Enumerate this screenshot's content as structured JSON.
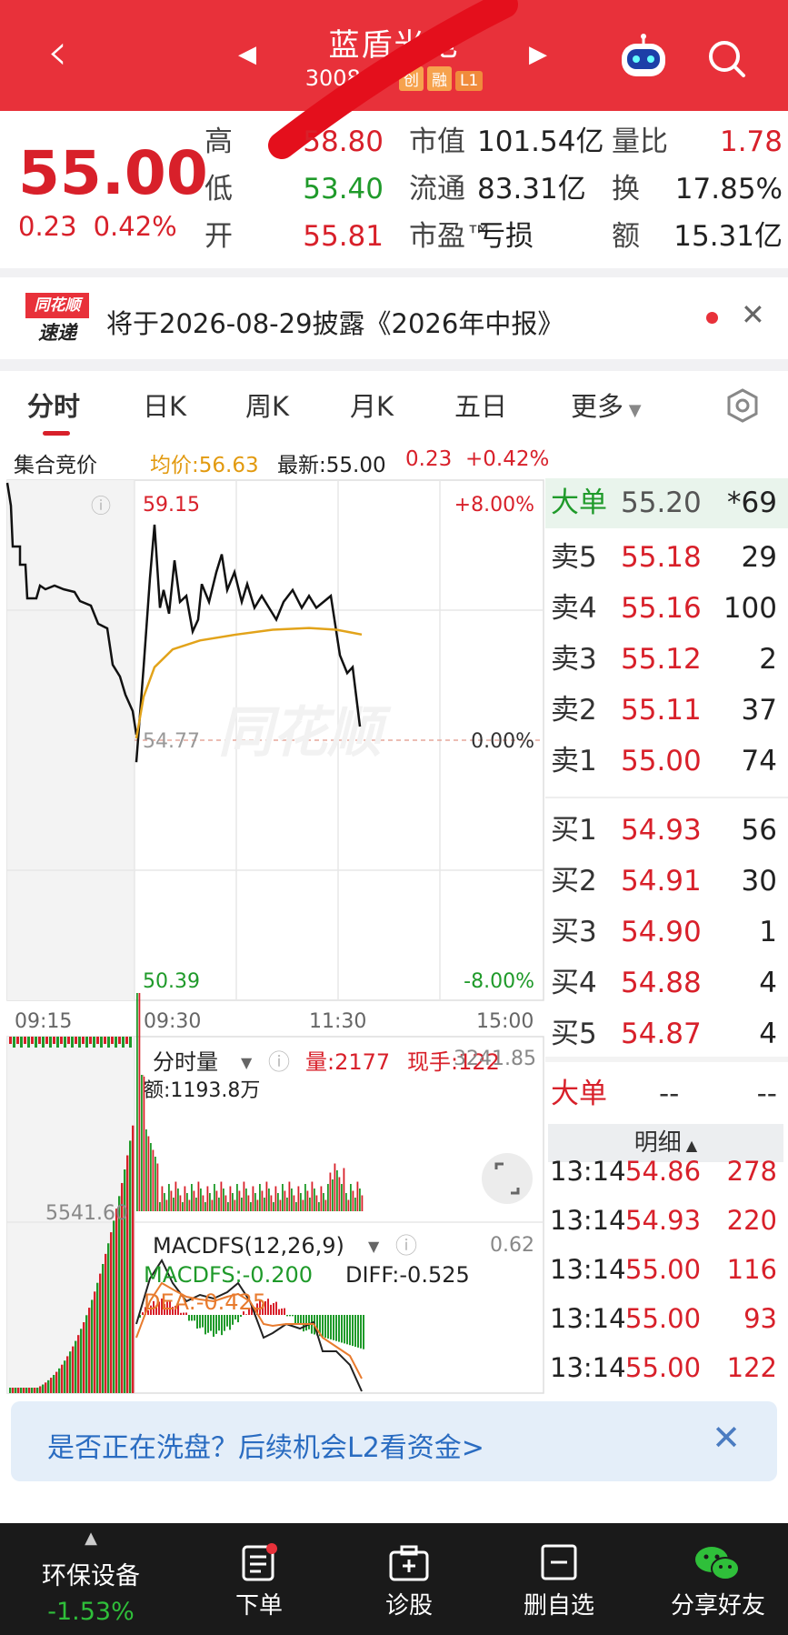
{
  "header": {
    "stock_name": "蓝盾光电",
    "stock_code": "300862",
    "tags": [
      "创",
      "融",
      "L1"
    ]
  },
  "quote": {
    "price": "55.00",
    "change": "0.23",
    "change_pct": "0.42%",
    "rows": [
      {
        "k1": "高",
        "v1": "58.80",
        "k2": "市值",
        "v2": "101.54亿",
        "k3": "量比",
        "v3": "1.78"
      },
      {
        "k1": "低",
        "v1": "53.40",
        "k2": "流通",
        "v2": "83.31亿",
        "k3": "换",
        "v3": "17.85%"
      },
      {
        "k1": "开",
        "v1": "55.81",
        "k2": "市盈™",
        "v2": "亏损",
        "k3": "额",
        "v3": "15.31亿"
      }
    ]
  },
  "notice": {
    "logo_top": "同花顺",
    "logo_bottom": "速递",
    "text": "将于2026-08-29披露《2026年中报》"
  },
  "tabs": [
    "分时",
    "日K",
    "周K",
    "月K",
    "五日",
    "更多"
  ],
  "infobar": {
    "label": "集合竞价",
    "avg": "均价:56.63",
    "latest": "最新:55.00",
    "chg": "0.23",
    "pct": "+0.42%"
  },
  "chart": {
    "y_top": "59.15",
    "y_mid": "54.77",
    "y_bot": "50.39",
    "pct_top": "+8.00%",
    "pct_mid": "0.00%",
    "pct_bot": "-8.00%",
    "times": [
      "09:15",
      "09:30",
      "11:30",
      "15:00"
    ],
    "auction_level": "5541.60",
    "vol_label": "分时量",
    "vol": "量:2177",
    "now_hand": "现手:122",
    "vol_right": "3241.85",
    "amount": "额:1193.8万",
    "macd_label": "MACDFS(12,26,9)",
    "macd_right": "0.62",
    "macd_val": "MACDFS:-0.200",
    "diff": "DIFF:-0.525",
    "dea": "DEA:-0.425"
  },
  "chart_data": {
    "type": "line",
    "x": [
      "09:30",
      "10:00",
      "10:30",
      "11:00",
      "11:30",
      "13:00",
      "13:14"
    ],
    "series": [
      {
        "name": "最新",
        "values": [
          54.4,
          58.4,
          57.4,
          58.1,
          57.6,
          57.2,
          55.0
        ]
      },
      {
        "name": "均价",
        "values": [
          54.8,
          56.3,
          56.5,
          56.6,
          56.7,
          56.8,
          56.63
        ]
      }
    ],
    "ylim": [
      50.39,
      59.15
    ]
  },
  "orderbook": {
    "big_top": {
      "k": "大单",
      "p": "55.20",
      "v": "*69"
    },
    "asks": [
      {
        "k": "卖5",
        "p": "55.18",
        "v": "29"
      },
      {
        "k": "卖4",
        "p": "55.16",
        "v": "100"
      },
      {
        "k": "卖3",
        "p": "55.12",
        "v": "2"
      },
      {
        "k": "卖2",
        "p": "55.11",
        "v": "37"
      },
      {
        "k": "卖1",
        "p": "55.00",
        "v": "74"
      }
    ],
    "bids": [
      {
        "k": "买1",
        "p": "54.93",
        "v": "56"
      },
      {
        "k": "买2",
        "p": "54.91",
        "v": "30"
      },
      {
        "k": "买3",
        "p": "54.90",
        "v": "1"
      },
      {
        "k": "买4",
        "p": "54.88",
        "v": "4"
      },
      {
        "k": "买5",
        "p": "54.87",
        "v": "4"
      }
    ],
    "big2": {
      "k": "大单",
      "p": "--",
      "v": "--"
    },
    "detail_label": "明细"
  },
  "details": [
    {
      "t": "13:14",
      "p": "54.86",
      "v": "278"
    },
    {
      "t": "13:14",
      "p": "54.93",
      "v": "220"
    },
    {
      "t": "13:14",
      "p": "55.00",
      "v": "116"
    },
    {
      "t": "13:14",
      "p": "55.00",
      "v": "93"
    },
    {
      "t": "13:14",
      "p": "55.00",
      "v": "122"
    }
  ],
  "banner": {
    "text": "是否正在洗盘？后续机会L2看资金>"
  },
  "bottom_nav": {
    "sector": "环保设备",
    "sector_pct": "-1.53%",
    "items": [
      "下单",
      "诊股",
      "删自选",
      "分享好友"
    ]
  }
}
